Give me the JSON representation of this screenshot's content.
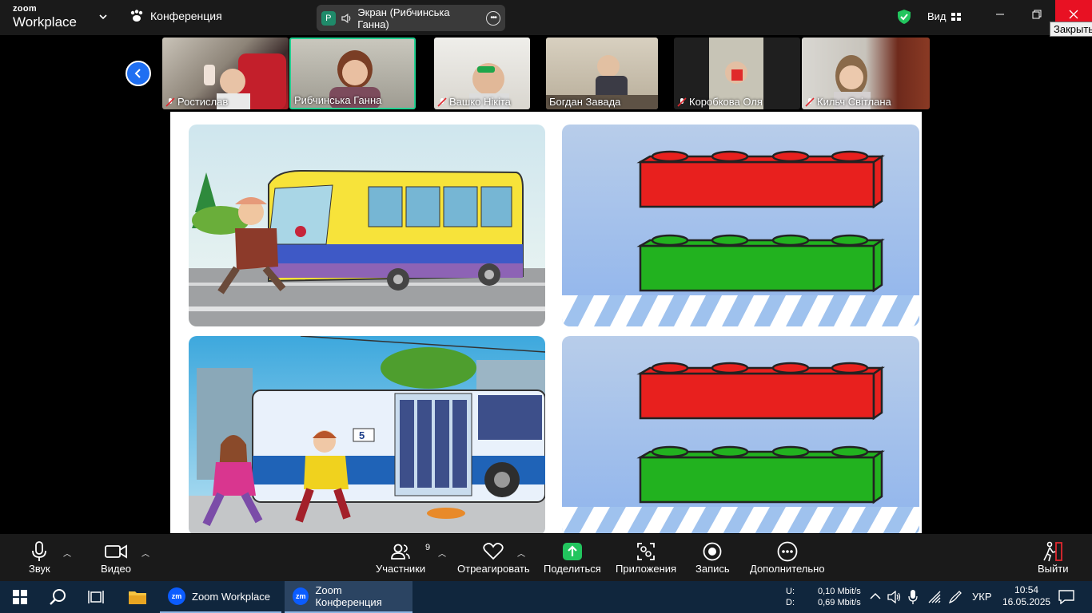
{
  "app": {
    "logo_line1": "zoom",
    "logo_line2": "Workplace",
    "meeting_label": "Конференция",
    "share_badge": "P",
    "share_label": "Экран (Рибчинська Ганна)",
    "view_label": "Вид",
    "close_tooltip": "Закрыть"
  },
  "participants": [
    {
      "name": "Ростислав",
      "muted": true
    },
    {
      "name": "Рибчинська Ганна",
      "muted": false,
      "active": true
    },
    {
      "name": "Вашко Нікіта",
      "muted": true
    },
    {
      "name": "Богдан Завада",
      "muted": false
    },
    {
      "name": "Коробкова Оля",
      "muted": true
    },
    {
      "name": "Кильч  Світлана",
      "muted": true
    }
  ],
  "shared_content": {
    "bus_number": "5",
    "panels": [
      "bus-scene",
      "red-green-blocks",
      "trolleybus-scene",
      "red-green-blocks"
    ]
  },
  "toolbar": {
    "audio": "Звук",
    "video": "Видео",
    "participants": "Участники",
    "participants_count": "9",
    "react": "Отреагировать",
    "share": "Поделиться",
    "apps": "Приложения",
    "record": "Запись",
    "more": "Дополнительно",
    "leave": "Выйти"
  },
  "taskbar": {
    "apps": [
      "Zoom Workplace",
      "Zoom Конференция"
    ],
    "net_up_label": "U:",
    "net_up": "0,10 Mbit/s",
    "net_down_label": "D:",
    "net_down": "0,69 Mbit/s",
    "lang": "УКР",
    "time": "10:54",
    "date": "16.05.2025"
  },
  "colors": {
    "accent_green": "#22d191",
    "zoom_blue": "#0b5cff",
    "brick_red": "#e8201e",
    "brick_green": "#22b21f",
    "close_red": "#e81123"
  }
}
